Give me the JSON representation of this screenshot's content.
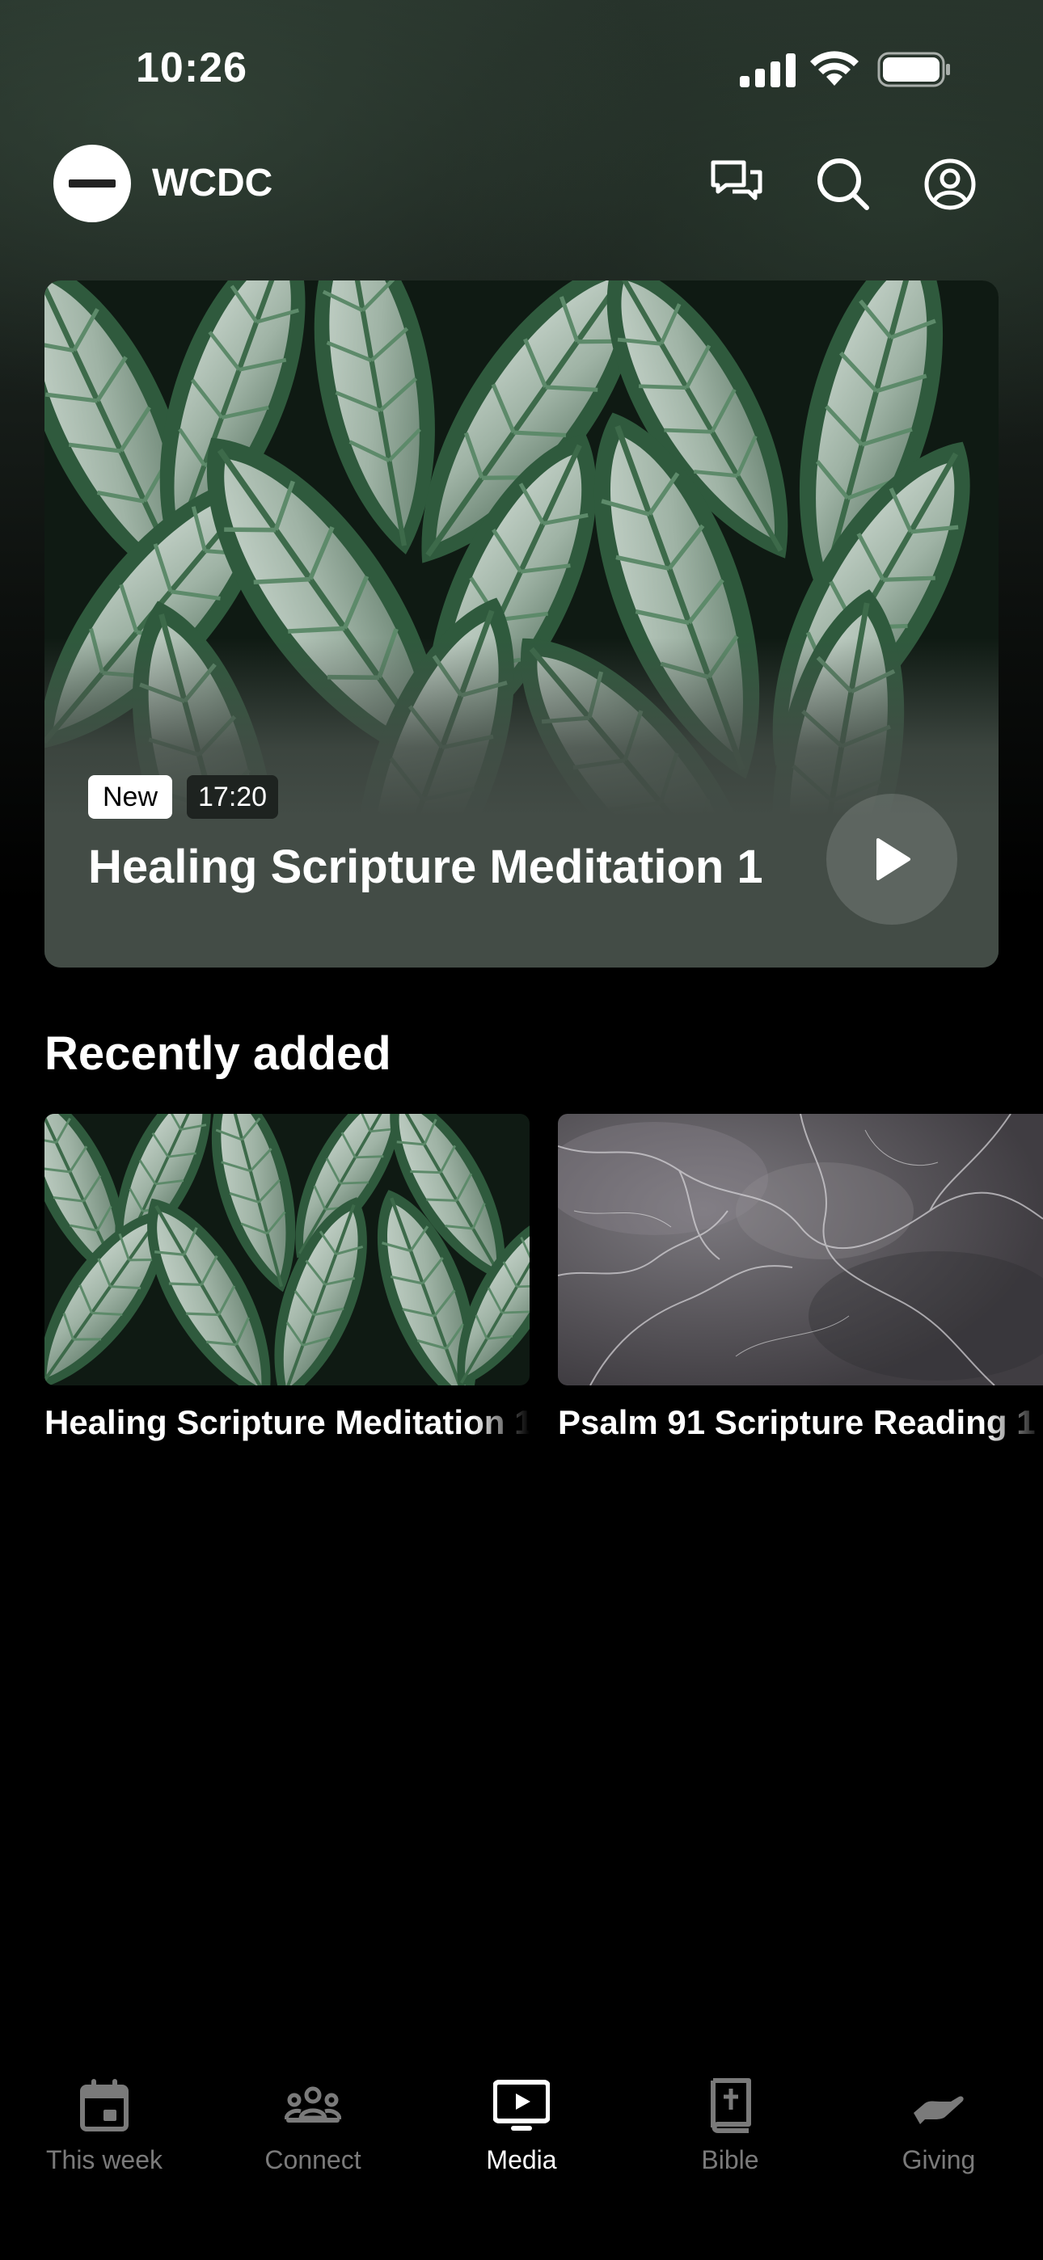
{
  "status_bar": {
    "time": "10:26"
  },
  "header": {
    "app_name": "WCDC",
    "icons": [
      "chat-icon",
      "search-icon",
      "profile-icon"
    ]
  },
  "featured": {
    "badge_new": "New",
    "duration": "17:20",
    "title": "Healing Scripture Meditation 1"
  },
  "recently_added": {
    "heading": "Recently added",
    "items": [
      {
        "title": "Healing Scripture Meditation 1",
        "thumb": "leaves"
      },
      {
        "title": "Psalm 91 Scripture Reading 1",
        "thumb": "marble"
      }
    ]
  },
  "tabs": [
    {
      "label": "This week",
      "icon": "calendar-icon",
      "active": false
    },
    {
      "label": "Connect",
      "icon": "people-icon",
      "active": false
    },
    {
      "label": "Media",
      "icon": "tv-icon",
      "active": true
    },
    {
      "label": "Bible",
      "icon": "bible-icon",
      "active": false
    },
    {
      "label": "Giving",
      "icon": "giving-hand-icon",
      "active": false
    }
  ],
  "colors": {
    "background": "#000000",
    "hero_card": "#434c46",
    "tab_inactive": "#7a7a7a",
    "tab_active": "#ffffff"
  }
}
